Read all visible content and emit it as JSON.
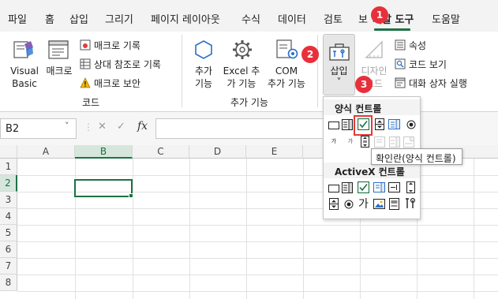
{
  "menu_tabs": [
    "파일",
    "홈",
    "삽입",
    "그리기",
    "페이지 레이아웃",
    "수식",
    "데이터",
    "검토",
    "보기",
    "개발 도구",
    "도움말"
  ],
  "active_tab": "개발 도구",
  "accent_color": "#1e7145",
  "callout_color": "#e8303b",
  "ribbon": {
    "code_group": {
      "visual_basic": [
        "Visual",
        "Basic"
      ],
      "macros": "매크로",
      "record_macro": "매크로 기록",
      "relative_reference": "상대 참조로 기록",
      "macro_security": "매크로 보안",
      "group_label": "코드"
    },
    "addins_group": {
      "addins": [
        "추가",
        "기능"
      ],
      "excel_addins": [
        "Excel 추",
        "가 기능"
      ],
      "com_addins": [
        "COM",
        "추가 기능"
      ],
      "group_label": "추가 기능"
    },
    "controls_group": {
      "insert": "삽입",
      "insert_chevron": "˅",
      "design_mode": [
        "디자인",
        "모드"
      ],
      "properties": "속성",
      "view_code": "코드 보기",
      "run_dialog": "대화 상자 실행"
    }
  },
  "callouts": [
    "1",
    "2",
    "3"
  ],
  "formula_bar": {
    "name_box": "B2",
    "fx_label": "fx",
    "cancel_label": "✕",
    "enter_label": "✓",
    "value": ""
  },
  "grid": {
    "columns": [
      "A",
      "B",
      "C",
      "D",
      "E"
    ],
    "rows": [
      "1",
      "2",
      "3",
      "4",
      "5",
      "6",
      "7",
      "8"
    ],
    "selected_cell": "B2"
  },
  "insert_dropdown": {
    "form_controls_header": "양식 컨트롤",
    "activex_header": "ActiveX 컨트롤",
    "label_glyph": "가",
    "tooltip": "확인란(양식 컨트롤)"
  }
}
